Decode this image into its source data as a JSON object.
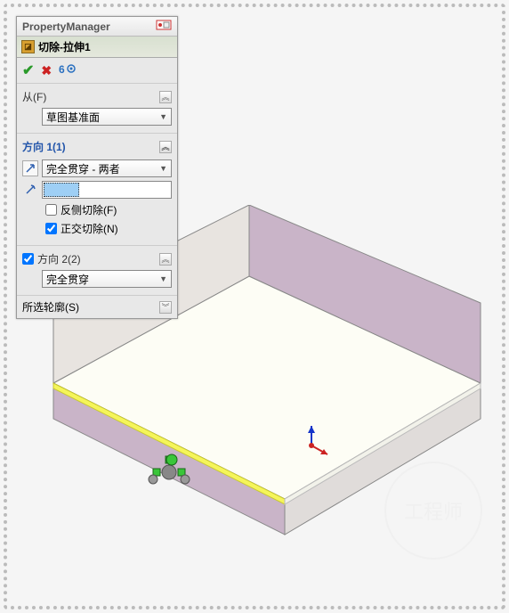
{
  "panel": {
    "title": "PropertyManager",
    "feature_name": "切除-拉伸1",
    "buttons": {
      "ok": "✔",
      "cancel": "✖",
      "detail": "6ởʳ"
    }
  },
  "from": {
    "label": "从(F)",
    "value": "草图基准面"
  },
  "dir1": {
    "label": "方向 1(1)",
    "end_condition": "完全贯穿 - 两者",
    "selection": "",
    "flip_label": "反侧切除(F)",
    "flip_checked": false,
    "normal_label": "正交切除(N)",
    "normal_checked": true
  },
  "dir2": {
    "label": "方向 2(2)",
    "checked": true,
    "end_condition": "完全贯穿"
  },
  "contours": {
    "label": "所选轮廓(S)"
  },
  "watermark": "工程师"
}
